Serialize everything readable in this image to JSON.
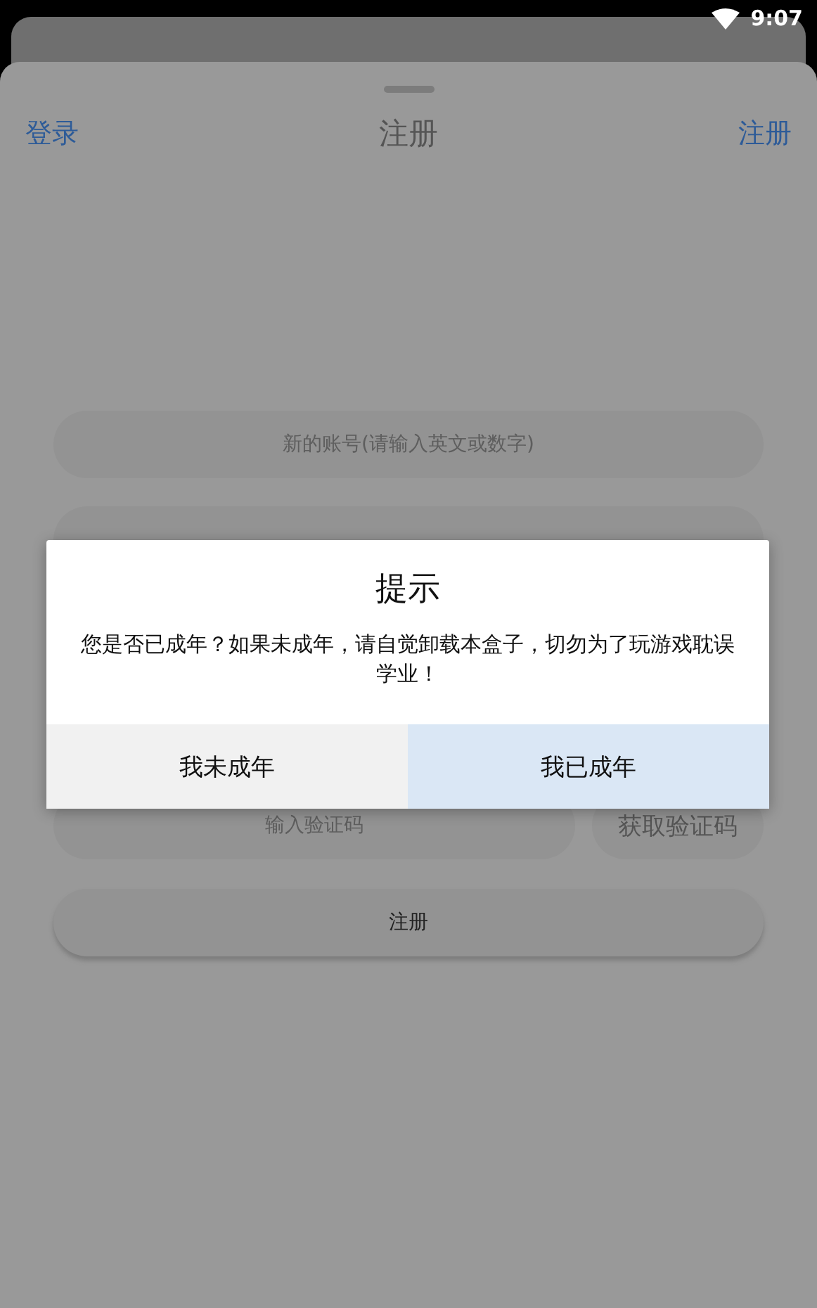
{
  "status_bar": {
    "time": "9:07"
  },
  "header": {
    "left_link": "登录",
    "title": "注册",
    "right_link": "注册"
  },
  "form": {
    "account_field": {
      "placeholder": "新的账号(请输入英文或数字)"
    },
    "code_field": {
      "placeholder": "输入验证码"
    },
    "get_code_button": "获取验证码",
    "submit_button": "注册"
  },
  "dialog": {
    "title": "提示",
    "message": "您是否已成年？如果未成年，请自觉卸载本盒子，切勿为了玩游戏耽误学业！",
    "buttons": [
      {
        "label": "我未成年",
        "selected": false
      },
      {
        "label": "我已成年",
        "selected": true
      }
    ]
  }
}
